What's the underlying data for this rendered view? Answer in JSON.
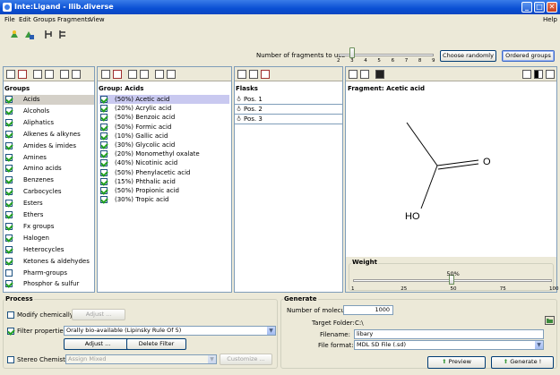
{
  "window": {
    "title": "Inte:Ligand - llib.diverse",
    "minimize": "_",
    "maximize": "□",
    "close": "✕"
  },
  "menu": {
    "file": "File",
    "edit": "Edit",
    "groups": "Groups",
    "fragments": "Fragments",
    "view": "View",
    "help": "Help"
  },
  "fragments_control": {
    "label": "Number of fragments to use",
    "ticks": [
      "2",
      "3",
      "4",
      "5",
      "6",
      "7",
      "8",
      "9"
    ],
    "value": 3,
    "choose_randomly": "Choose randomly",
    "ordered_groups": "Ordered groups"
  },
  "groups": {
    "heading": "Groups",
    "items": [
      {
        "label": "Acids",
        "checked": true,
        "selected": true
      },
      {
        "label": "Alcohols",
        "checked": true
      },
      {
        "label": "Aliphatics",
        "checked": true
      },
      {
        "label": "Alkenes & alkynes",
        "checked": true
      },
      {
        "label": "Amides & imides",
        "checked": true
      },
      {
        "label": "Amines",
        "checked": true
      },
      {
        "label": "Amino acids",
        "checked": true
      },
      {
        "label": "Benzenes",
        "checked": true
      },
      {
        "label": "Carbocycles",
        "checked": true
      },
      {
        "label": "Esters",
        "checked": true
      },
      {
        "label": "Ethers",
        "checked": true
      },
      {
        "label": "Fx groups",
        "checked": true
      },
      {
        "label": "Halogen",
        "checked": true
      },
      {
        "label": "Heterocycles",
        "checked": true
      },
      {
        "label": "Ketones & aldehydes",
        "checked": true
      },
      {
        "label": "Pharm-groups",
        "checked": false
      },
      {
        "label": "Phosphor & sulfur",
        "checked": true
      }
    ]
  },
  "group_acids": {
    "heading": "Group: Acids",
    "items": [
      {
        "label": "(50%) Acetic acid",
        "checked": true,
        "selected": true
      },
      {
        "label": "(20%) Acrylic acid",
        "checked": true
      },
      {
        "label": "(50%) Benzoic acid",
        "checked": true
      },
      {
        "label": "(50%) Formic acid",
        "checked": true
      },
      {
        "label": "(10%) Gallic acid",
        "checked": true
      },
      {
        "label": "(30%) Glycolic acid",
        "checked": true
      },
      {
        "label": "(20%) Monomethyl oxalate",
        "checked": true
      },
      {
        "label": "(40%) Nicotinic acid",
        "checked": true
      },
      {
        "label": "(50%) Phenylacetic acid",
        "checked": true
      },
      {
        "label": "(15%) Phthalic acid",
        "checked": true
      },
      {
        "label": "(50%) Propionic acid",
        "checked": true
      },
      {
        "label": "(30%) Tropic acid",
        "checked": true
      }
    ]
  },
  "flasks": {
    "heading": "Flasks",
    "items": [
      {
        "label": "Pos. 1"
      },
      {
        "label": "Pos. 2"
      },
      {
        "label": "Pos. 3"
      }
    ]
  },
  "fragment": {
    "heading": "Fragment: Acetic acid",
    "atom_o": "O",
    "atom_oh": "HO",
    "weight_label": "Weight",
    "weight_value": 50,
    "weight_value_text": "50%",
    "weight_ticks": [
      "1",
      "25",
      "50",
      "75",
      "100"
    ]
  },
  "process": {
    "heading": "Process",
    "modify_label": "Modify chemically",
    "modify_checked": false,
    "adjust_disabled": "Adjust ...",
    "filter_label": "Filter properties",
    "filter_checked": true,
    "filter_value": "Orally bio-available (Lipinsky Rule Of 5)",
    "adjust": "Adjust ...",
    "delete_filter": "Delete Filter",
    "stereo_label": "Stereo Chemistry",
    "stereo_checked": false,
    "stereo_value": "Assign Mixed",
    "customize": "Customize ..."
  },
  "generate": {
    "heading": "Generate",
    "num_label": "Number of molecules:",
    "num_value": "1000",
    "folder_label": "Target Folder:",
    "folder_value": "C:\\",
    "filename_label": "Filename:",
    "filename_value": "libary",
    "format_label": "File format:",
    "format_value": "MDL SD File (.sd)",
    "preview": "Preview",
    "generate": "Generate !"
  }
}
